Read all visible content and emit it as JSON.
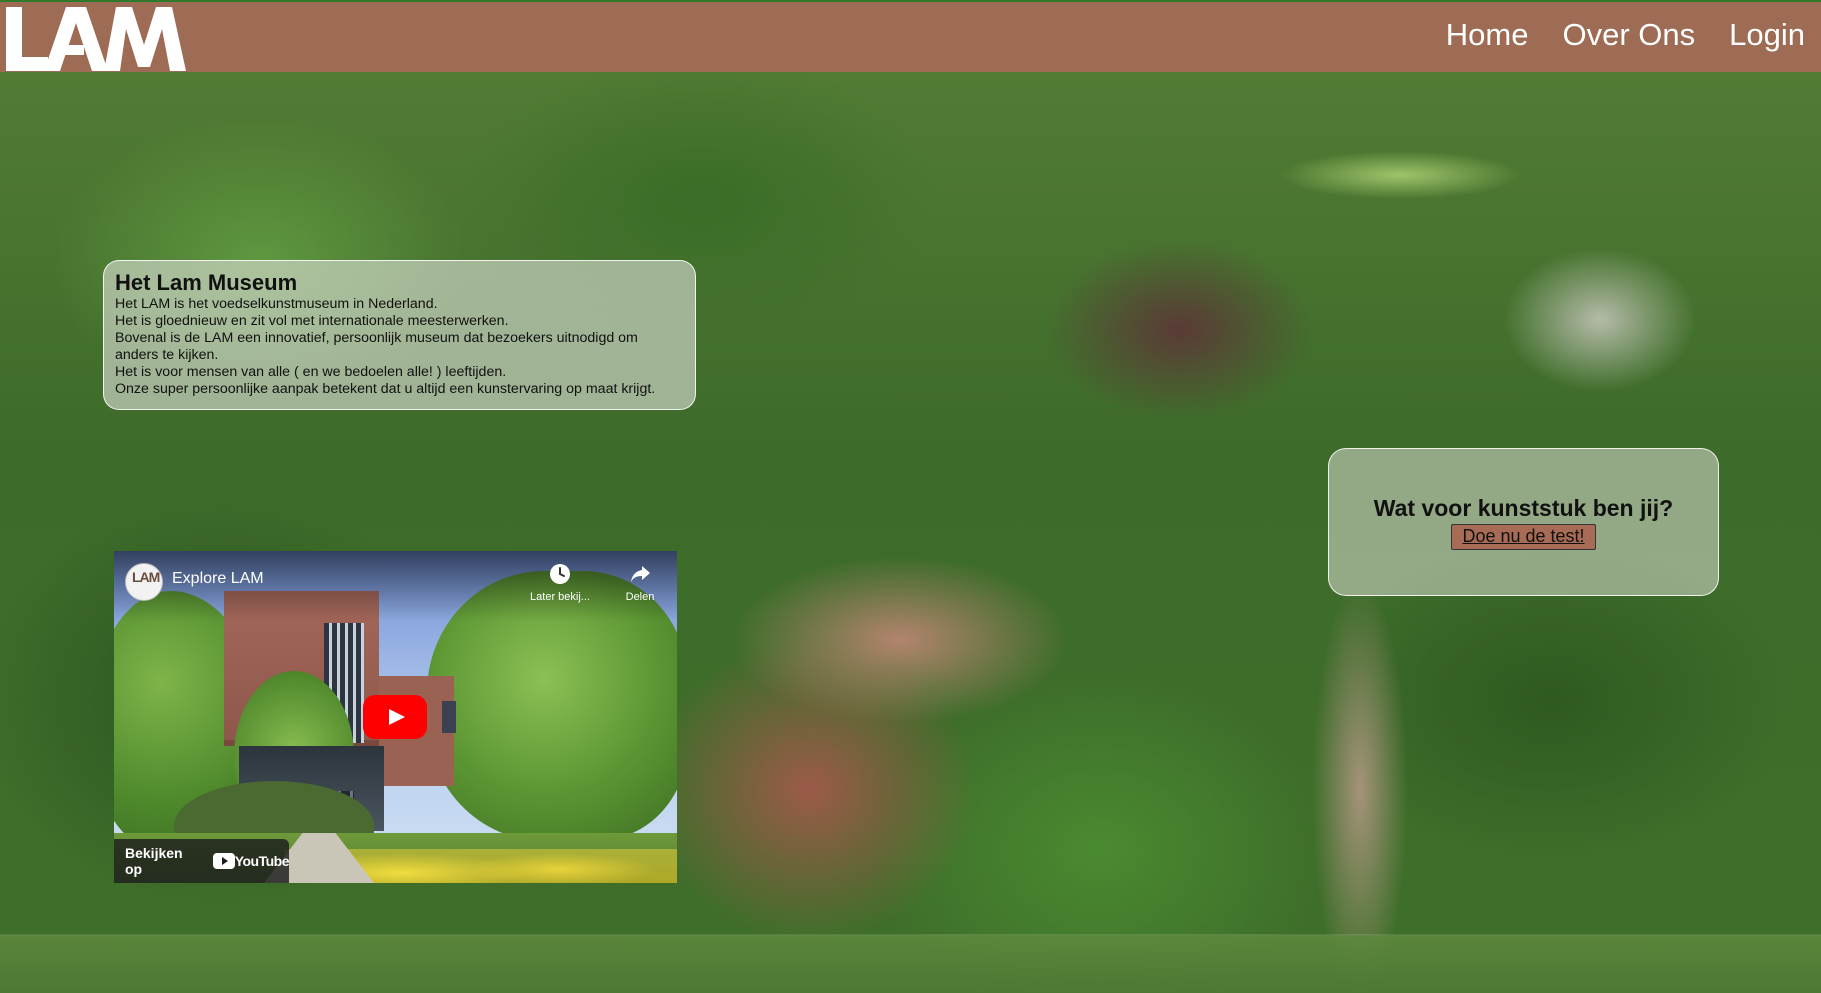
{
  "header": {
    "logo_text": "LAM",
    "nav": [
      {
        "label": "Home"
      },
      {
        "label": "Over Ons"
      },
      {
        "label": "Login"
      }
    ],
    "colors": {
      "bar": "#9e6b54",
      "text": "#ffffff",
      "top_line": "#2f7a2a"
    }
  },
  "info": {
    "title": "Het Lam Museum",
    "lines": [
      "Het LAM is het voedselkunstmuseum in Nederland.",
      "Het is gloednieuw en zit vol met internationale meesterwerken.",
      "Bovenal is de LAM een innovatief, persoonlijk museum dat bezoekers uitnodigd om",
      "anders te kijken.",
      "Het is voor mensen van alle ( en we bedoelen alle! ) leeftijden.",
      "Onze super persoonlijke aanpak betekent dat u altijd een kunstervaring op maat krijgt."
    ]
  },
  "quiz": {
    "question": "Wat voor kunststuk ben jij?",
    "cta_label": "Doe nu de test!",
    "cta_color": "#a86b55"
  },
  "video": {
    "title": "Explore LAM",
    "channel_icon": "lam-channel-avatar",
    "watch_later_label": "Later bekij...",
    "share_label": "Delen",
    "watch_on_label": "Bekijken op",
    "platform_label": "YouTube",
    "play_icon": "play-icon",
    "play_color": "#ff0000"
  },
  "background": {
    "description_icon": "blurred-forest-background"
  }
}
